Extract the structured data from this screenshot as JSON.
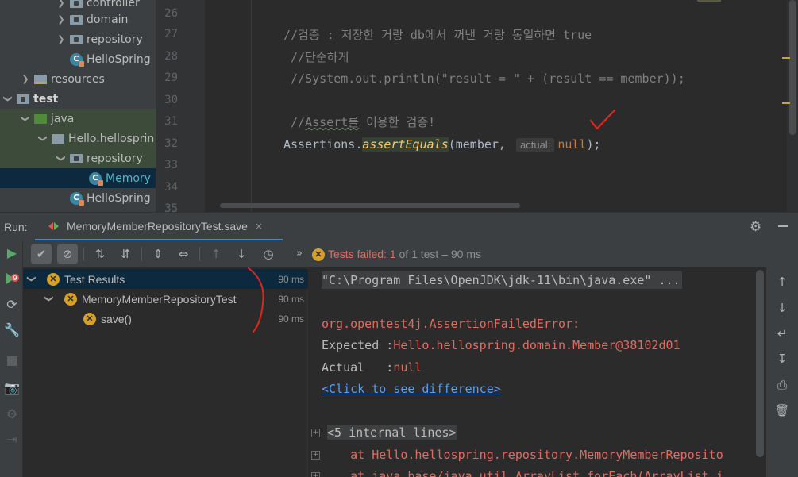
{
  "project_tree": {
    "items": [
      {
        "label": "controller",
        "kind": "folder",
        "expanded": false
      },
      {
        "label": "domain",
        "kind": "folder",
        "expanded": false
      },
      {
        "label": "repository",
        "kind": "folder",
        "expanded": false
      },
      {
        "label": "HelloSpring",
        "kind": "class"
      },
      {
        "label": "resources",
        "kind": "resources",
        "expanded": false
      },
      {
        "label": "test",
        "kind": "folder",
        "expanded": true
      },
      {
        "label": "java",
        "kind": "source",
        "expanded": true
      },
      {
        "label": "Hello.hellosprin",
        "kind": "package",
        "expanded": true
      },
      {
        "label": "repository",
        "kind": "folder",
        "expanded": true
      },
      {
        "label": "Memory",
        "kind": "test-class",
        "selected": true
      },
      {
        "label": "HelloSpring",
        "kind": "class"
      },
      {
        "label": "",
        "kind": "folder"
      }
    ]
  },
  "editor": {
    "lines": [
      {
        "number": "26"
      },
      {
        "number": "27",
        "text": "//검증 : 저장한 거랑 db에서 꺼낸 거랑 동일하면 true"
      },
      {
        "number": "28",
        "text": " //단순하게"
      },
      {
        "number": "29",
        "text": " //System.out.println(\"result = \" + (result == member));"
      },
      {
        "number": "30"
      },
      {
        "number": "31",
        "text_a": " //",
        "text_b": "Assert를",
        "text_c": " 이용한 검증!"
      },
      {
        "number": "32",
        "cls": "Assertions",
        "dot": ".",
        "method": "assertEquals",
        "args": "(member, ",
        "hint": "actual:",
        "value": "null",
        "end": ");"
      },
      {
        "number": "33"
      },
      {
        "number": "34"
      },
      {
        "number": "35"
      }
    ]
  },
  "run": {
    "label": "Run:",
    "tab_title": "MemoryMemberRepositoryTest.save",
    "tab_close": "×",
    "status": {
      "failed_text": "Tests failed: 1",
      "rest_text": " of 1 test – 90 ms"
    },
    "results": [
      {
        "label": "Test Results",
        "time": "90 ms",
        "selected": true
      },
      {
        "label": "MemoryMemberRepositoryTest",
        "time": "90 ms"
      },
      {
        "label": "save()",
        "time": "90 ms"
      }
    ],
    "console": {
      "cmd": "\"C:\\Program Files\\OpenJDK\\jdk-11\\bin\\java.exe\" ...",
      "error": "org.opentest4j.AssertionFailedError:",
      "expected_label": "Expected :",
      "expected_value": "Hello.hellospring.domain.Member@38102d01",
      "actual_label": "Actual   :",
      "actual_value": "null",
      "diff_link": "<Click to see difference>",
      "internal": "<5 internal lines>",
      "stack1": "    at Hello.hellospring.repository.MemoryMemberReposito",
      "stack2": "    at java.base/java.util.ArrayList.forEach(ArrayList.j"
    }
  },
  "colors": {
    "accent": "#4a88c7",
    "error": "#e06c61",
    "warning": "#d7a028",
    "pass": "#5fb35f"
  }
}
